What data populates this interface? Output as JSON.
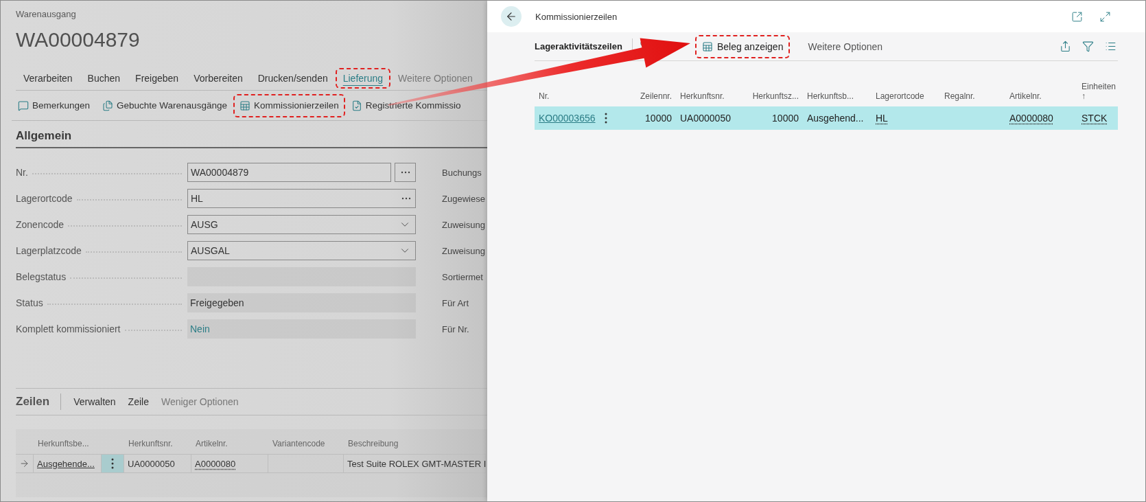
{
  "page": {
    "breadcrumb": "Warenausgang",
    "title": "WA00004879",
    "menu": [
      {
        "label": "Verarbeiten",
        "selected": false,
        "highlighted": false,
        "kind": "action"
      },
      {
        "label": "Buchen",
        "selected": false,
        "highlighted": false,
        "kind": "action"
      },
      {
        "label": "Freigeben",
        "selected": false,
        "highlighted": false,
        "kind": "action"
      },
      {
        "label": "Vorbereiten",
        "selected": false,
        "highlighted": false,
        "kind": "action"
      },
      {
        "label": "Drucken/senden",
        "selected": false,
        "highlighted": false,
        "kind": "action"
      },
      {
        "label": "Lieferung",
        "selected": true,
        "highlighted": true,
        "kind": "action"
      },
      {
        "label": "Weitere Optionen",
        "selected": false,
        "highlighted": false,
        "kind": "more"
      }
    ],
    "actions": [
      {
        "label": "Bemerkungen",
        "highlighted": false
      },
      {
        "label": "Gebuchte Warenausgänge",
        "highlighted": false
      },
      {
        "label": "Kommissionierzeilen",
        "highlighted": true
      },
      {
        "label": "Registrierte Kommissio",
        "highlighted": false
      }
    ],
    "section": "Allgemein",
    "fields": [
      {
        "label": "Nr.",
        "value": "WA00004879",
        "kind": "lookup",
        "side_label": "Buchungs"
      },
      {
        "label": "Lagerortcode",
        "value": "HL",
        "kind": "ellipsis",
        "side_label": "Zugewiese"
      },
      {
        "label": "Zonencode",
        "value": "AUSG",
        "kind": "dropdown",
        "side_label": "Zuweisung"
      },
      {
        "label": "Lagerplatzcode",
        "value": "AUSGAL",
        "kind": "dropdown",
        "side_label": "Zuweisung"
      },
      {
        "label": "Belegstatus",
        "kind": "readonly",
        "side_label": "Sortiermet"
      },
      {
        "label": "Status",
        "value": "Freigegeben",
        "kind": "readonly",
        "side_label": "Für Art"
      },
      {
        "label": "Komplett kommissioniert",
        "value": "Nein",
        "kind": "boolean",
        "side_label": "Für Nr."
      }
    ],
    "lines": {
      "title": "Zeilen",
      "actions": [
        {
          "label": "Verwalten",
          "kind": "action"
        },
        {
          "label": "Zeile",
          "kind": "action"
        },
        {
          "label": "Weniger Optionen",
          "kind": "more"
        }
      ],
      "columns": [
        "Herkunftsbe...",
        "Herkunftsnr.",
        "Artikelnr.",
        "Variantencode",
        "Beschreibung"
      ],
      "rows": [
        {
          "selected": true,
          "cells": [
            {
              "text": "Ausgehende...",
              "kind": "link"
            },
            {
              "text": "UA0000050",
              "kind": "plain"
            },
            {
              "text": "A0000080",
              "kind": "lookup"
            },
            {
              "kind": "empty"
            },
            {
              "text": "Test Suite ROLEX GMT-MASTER I",
              "kind": "plain"
            }
          ]
        }
      ]
    }
  },
  "panel": {
    "title": "Kommissionierzeilen",
    "toolbar": {
      "title": "Lageraktivitätszeilen",
      "actions": [
        {
          "label": "Beleg anzeigen",
          "highlighted": true,
          "kind": "action"
        },
        {
          "label": "Weitere Optionen",
          "highlighted": false,
          "kind": "more"
        }
      ]
    },
    "columns": [
      {
        "label": "Nr.",
        "kind": "text"
      },
      {
        "label": "Zeilennr.",
        "kind": "number"
      },
      {
        "label": "Herkunftsnr.",
        "kind": "text"
      },
      {
        "label": "Herkunftsz...",
        "kind": "number"
      },
      {
        "label": "Herkunftsb...",
        "kind": "text"
      },
      {
        "label": "Lagerortcode",
        "kind": "text"
      },
      {
        "label": "Regalnr.",
        "kind": "text"
      },
      {
        "label": "Artikelnr.",
        "kind": "text"
      },
      {
        "label": "Einheiten",
        "kind": "text",
        "sort": "↑"
      }
    ],
    "rows": [
      {
        "selected": true,
        "cells": [
          {
            "text": "KO00003656",
            "kind": "link"
          },
          {
            "text": "10000",
            "kind": "plain"
          },
          {
            "text": "UA0000050",
            "kind": "plain"
          },
          {
            "text": "10000",
            "kind": "plain"
          },
          {
            "text": "Ausgehend...",
            "kind": "plain"
          },
          {
            "text": "HL",
            "kind": "lookup"
          },
          {
            "kind": "empty"
          },
          {
            "text": "A0000080",
            "kind": "lookup"
          },
          {
            "text": "STCK",
            "kind": "lookup"
          }
        ]
      }
    ]
  }
}
